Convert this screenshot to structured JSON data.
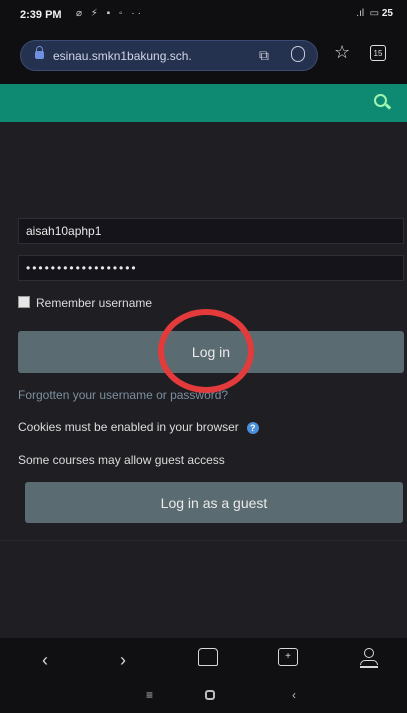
{
  "status_bar": {
    "time": "2:39 PM",
    "left_icons": "⌀ ⚡ ▪ ◦ ··",
    "signal": ".ıl",
    "battery": "25"
  },
  "browser": {
    "url": "esinau.smkn1bakung.sch.",
    "tab_count": "15"
  },
  "login_form": {
    "username_value": "aisah10aphp1",
    "password_value": "••••••••••••••••••",
    "remember_label": "Remember username",
    "login_button": "Log in",
    "forgot_link": "Forgotten your username or password?",
    "cookies_note": "Cookies must be enabled in your browser",
    "guest_note": "Some courses may allow guest access",
    "guest_button": "Log in as a guest"
  },
  "nav": {
    "back": "‹",
    "forward": "›",
    "tabs": "+"
  },
  "system_nav": {
    "recents": "≡",
    "back": "‹"
  },
  "colors": {
    "header": "#0f8a72",
    "button": "#5b6b72",
    "annotation_circle": "#e33b3b"
  }
}
